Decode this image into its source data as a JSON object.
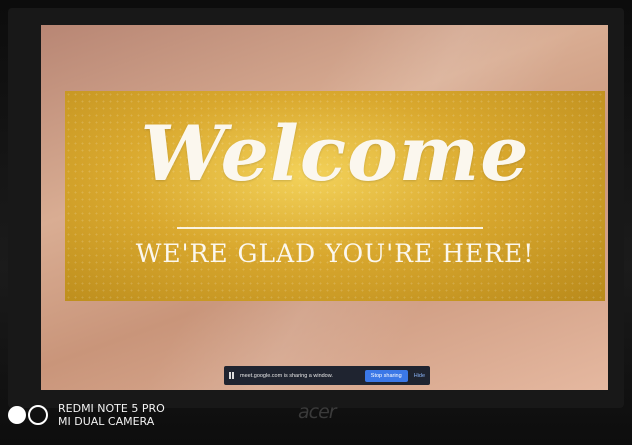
{
  "screen": {
    "banner": {
      "headline": "Welcome",
      "subheadline": "WE'RE GLAD YOU'RE HERE!"
    },
    "share_bar": {
      "message": "meet.google.com is sharing a window.",
      "stop_label": "Stop sharing",
      "hide_label": "Hide"
    }
  },
  "monitor": {
    "brand": "acer"
  },
  "camera_watermark": {
    "line1": "REDMI NOTE 5 PRO",
    "line2": "MI DUAL CAMERA"
  },
  "colors": {
    "banner_gold": "#d9a82e",
    "screen_background": "#d9ad93",
    "stop_button": "#3b78e7",
    "share_bar_bg": "#1f2430"
  }
}
